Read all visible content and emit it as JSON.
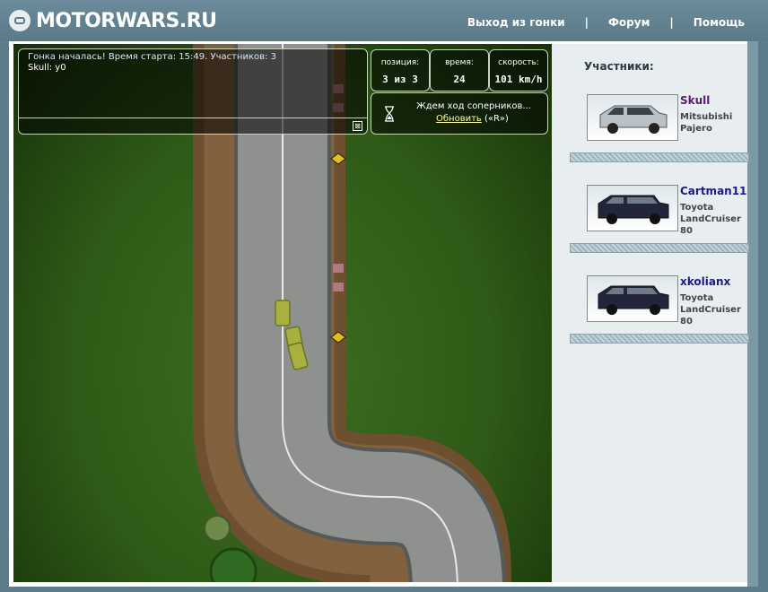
{
  "header": {
    "logo": "MOTORWARS.RU",
    "nav": [
      {
        "label": "Выход из гонки"
      },
      {
        "label": "Форум"
      },
      {
        "label": "Помощь"
      }
    ],
    "separator": "|"
  },
  "chat": {
    "line1": "Гонка началась! Время старта: 15:49. Участников: 3",
    "line2": "Skull: у0",
    "close": "⊠"
  },
  "stats": {
    "position": {
      "label": "позиция:",
      "value": "3 из 3"
    },
    "time": {
      "label": "время:",
      "value": "24"
    },
    "speed": {
      "label": "скорость:",
      "value": "101 km/h"
    }
  },
  "wait": {
    "text": "Ждем ход соперников...",
    "refresh": "Обновить",
    "hotkey": "(«R»)"
  },
  "sidebar": {
    "title": "Участники:",
    "players": [
      {
        "name": "Skull",
        "model_line1": "Mitsubishi",
        "model_line2": "Pajero",
        "model_line3": "",
        "name_color": "#5a1a6e",
        "car_color": "#b9c0c6"
      },
      {
        "name": "Cartman11",
        "model_line1": "Toyota",
        "model_line2": "LandCruiser",
        "model_line3": "80",
        "name_color": "#1a1a8a",
        "car_color": "#23263a"
      },
      {
        "name": "xkolianx",
        "model_line1": "Toyota",
        "model_line2": "LandCruiser",
        "model_line3": "80",
        "name_color": "#1a1a8a",
        "car_color": "#23263a"
      }
    ]
  },
  "colors": {
    "header_bg": "#5d7d8c",
    "grass": "#2f5a17",
    "road": "#8c8e8c",
    "dirt": "#7a5a3a"
  }
}
